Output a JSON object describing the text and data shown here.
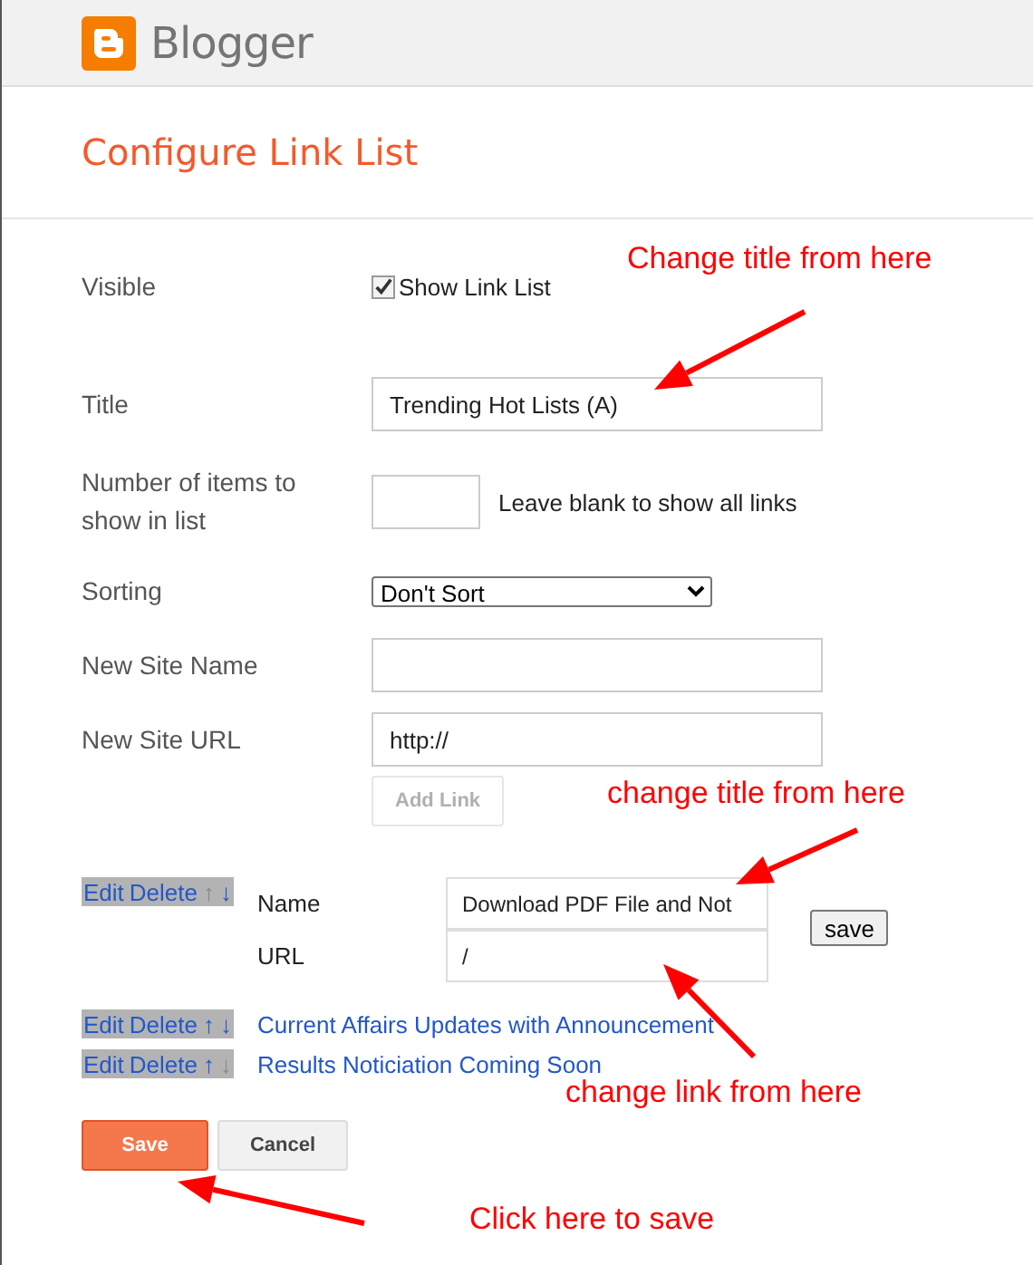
{
  "header": {
    "brand": "Blogger"
  },
  "page_title": "Configure Link List",
  "form": {
    "visible": {
      "label": "Visible",
      "checkbox_label": "Show Link List",
      "checked": true
    },
    "title": {
      "label": "Title",
      "value": "Trending Hot Lists (A)"
    },
    "count": {
      "label": "Number of items to show in list",
      "hint": "Leave blank to show all links"
    },
    "sorting": {
      "label": "Sorting",
      "value": "Don't Sort"
    },
    "new_site_name": {
      "label": "New Site Name"
    },
    "new_site_url": {
      "label": "New Site URL",
      "value": "http://"
    },
    "add_link": {
      "label": "Add Link",
      "disabled": true
    }
  },
  "links": [
    {
      "kind": "editing",
      "edit": "Edit",
      "delete": "Delete",
      "up": {
        "text": "↑",
        "disabled": true
      },
      "down": {
        "text": "↓",
        "disabled": false
      },
      "name_label": "Name",
      "name_value": "Download PDF File and Not",
      "url_label": "URL",
      "url_value": "/",
      "save": "save"
    },
    {
      "kind": "link",
      "edit": "Edit",
      "delete": "Delete",
      "up": {
        "text": "↑",
        "disabled": false
      },
      "down": {
        "text": "↓",
        "disabled": false
      },
      "title": "Current Affairs Updates with Announcement"
    },
    {
      "kind": "link",
      "edit": "Edit",
      "delete": "Delete",
      "up": {
        "text": "↑",
        "disabled": false
      },
      "down": {
        "text": "↓",
        "disabled": true
      },
      "title": "Results Noticiation Coming Soon"
    }
  ],
  "buttons": {
    "save": "Save",
    "cancel": "Cancel"
  },
  "annotations": [
    {
      "text": "Change title from here"
    },
    {
      "text": "change title from here"
    },
    {
      "text": "change link from here"
    },
    {
      "text": "Click here to save"
    }
  ]
}
